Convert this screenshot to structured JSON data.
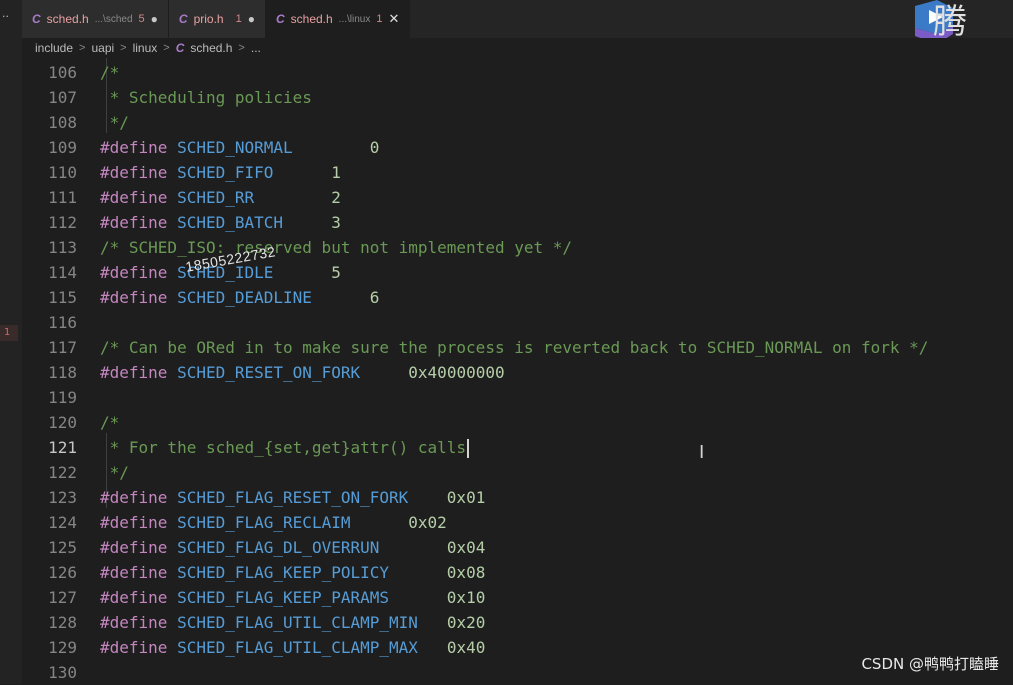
{
  "tabs": [
    {
      "c": "C",
      "name": "sched.h",
      "path": "...\\sched",
      "badge": "5",
      "marker": "●",
      "active": false
    },
    {
      "c": "C",
      "name": "prio.h",
      "path": "",
      "badge": "1",
      "marker": "●",
      "active": false
    },
    {
      "c": "C",
      "name": "sched.h",
      "path": "...\\linux",
      "badge": "1",
      "marker": "✕",
      "active": true
    }
  ],
  "logo_text": "腾",
  "activity_dots": "··",
  "gutter_marker": "1",
  "breadcrumb": {
    "parts": [
      "include",
      "uapi",
      "linux"
    ],
    "file_icon": "C",
    "file": "sched.h",
    "sep": ">",
    "tail": "..."
  },
  "lines": [
    {
      "n": "106",
      "text": "/*"
    },
    {
      "n": "107",
      "text": " * Scheduling policies"
    },
    {
      "n": "108",
      "text": " */"
    },
    {
      "n": "109",
      "kw": "#define",
      "macro": "SCHED_NORMAL",
      "pad": "        ",
      "value": "0"
    },
    {
      "n": "110",
      "kw": "#define",
      "macro": "SCHED_FIFO",
      "pad": "      ",
      "value": "1"
    },
    {
      "n": "111",
      "kw": "#define",
      "macro": "SCHED_RR",
      "pad": "        ",
      "value": "2"
    },
    {
      "n": "112",
      "kw": "#define",
      "macro": "SCHED_BATCH",
      "pad": "     ",
      "value": "3"
    },
    {
      "n": "113",
      "text": "/* SCHED_ISO: reserved but not implemented yet */"
    },
    {
      "n": "114",
      "kw": "#define",
      "macro": "SCHED_IDLE",
      "pad": "      ",
      "value": "5"
    },
    {
      "n": "115",
      "kw": "#define",
      "macro": "SCHED_DEADLINE",
      "pad": "      ",
      "value": "6"
    },
    {
      "n": "116",
      "text": ""
    },
    {
      "n": "117",
      "text": "/* Can be ORed in to make sure the process is reverted back to SCHED_NORMAL on fork */"
    },
    {
      "n": "118",
      "kw": "#define",
      "macro": "SCHED_RESET_ON_FORK",
      "pad": "     ",
      "value": "0x40000000"
    },
    {
      "n": "119",
      "text": ""
    },
    {
      "n": "120",
      "text": "/*"
    },
    {
      "n": "121",
      "text": " * For the sched_{set,get}attr() calls",
      "current": true
    },
    {
      "n": "122",
      "text": " */"
    },
    {
      "n": "123",
      "kw": "#define",
      "macro": "SCHED_FLAG_RESET_ON_FORK",
      "pad": "    ",
      "value": "0x01"
    },
    {
      "n": "124",
      "kw": "#define",
      "macro": "SCHED_FLAG_RECLAIM",
      "pad": "      ",
      "value": "0x02"
    },
    {
      "n": "125",
      "kw": "#define",
      "macro": "SCHED_FLAG_DL_OVERRUN",
      "pad": "       ",
      "value": "0x04"
    },
    {
      "n": "126",
      "kw": "#define",
      "macro": "SCHED_FLAG_KEEP_POLICY",
      "pad": "      ",
      "value": "0x08"
    },
    {
      "n": "127",
      "kw": "#define",
      "macro": "SCHED_FLAG_KEEP_PARAMS",
      "pad": "      ",
      "value": "0x10"
    },
    {
      "n": "128",
      "kw": "#define",
      "macro": "SCHED_FLAG_UTIL_CLAMP_MIN",
      "pad": "   ",
      "value": "0x20"
    },
    {
      "n": "129",
      "kw": "#define",
      "macro": "SCHED_FLAG_UTIL_CLAMP_MAX",
      "pad": "   ",
      "value": "0x40"
    },
    {
      "n": "130",
      "text": ""
    }
  ],
  "overlay_text": "18505222732",
  "watermark": "CSDN @鸭鸭打瞌睡",
  "ibeam": "I",
  "colors": {
    "background": "#1e1e1e",
    "keyword": "#c586c0",
    "macro": "#569cd6",
    "number": "#b5cea8",
    "comment": "#6a9955",
    "line_number": "#858585",
    "tab_text": "#e8a0a0"
  }
}
